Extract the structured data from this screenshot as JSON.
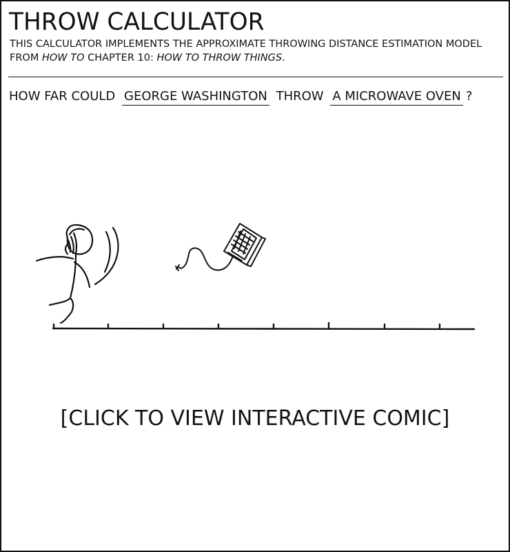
{
  "title": "THROW CALCULATOR",
  "description": {
    "line1": "THIS CALCULATOR IMPLEMENTS THE APPROXIMATE THROWING DISTANCE ESTIMATION MODEL",
    "line2_prefix": "FROM ",
    "line2_book": "HOW TO",
    "line2_middle": " CHAPTER 10: ",
    "line2_chapter": "HOW TO THROW THINGS",
    "line2_suffix": "."
  },
  "question": {
    "prefix": "HOW FAR COULD",
    "thrower": "GEORGE WASHINGTON",
    "middle": "THROW",
    "object": "A MICROWAVE OVEN",
    "suffix": "?"
  },
  "illustration": {
    "thrower_icon": "stick-figure-thrower-icon",
    "object_icon": "microwave-oven-icon",
    "ruler_icon": "distance-ruler-icon"
  },
  "call_to_action": "[CLICK TO VIEW INTERACTIVE COMIC]",
  "colors": {
    "ink": "#111111",
    "background": "#ffffff"
  }
}
